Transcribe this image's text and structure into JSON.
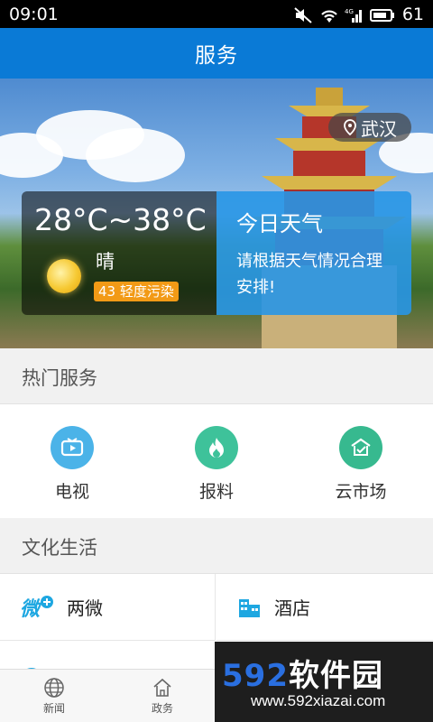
{
  "status_bar": {
    "time": "09:01",
    "network": "4G",
    "battery": "61"
  },
  "header": {
    "title": "服务"
  },
  "location": {
    "city": "武汉"
  },
  "weather": {
    "temperature": "28°C~38°C",
    "condition": "晴",
    "air_quality": "43 轻度污染"
  },
  "tip": {
    "title": "今日天气",
    "text": "请根据天气情况合理安排!"
  },
  "hot_services": {
    "title": "热门服务",
    "items": [
      {
        "label": "电视",
        "icon": "tv-icon",
        "color": "#4bb3e8"
      },
      {
        "label": "报料",
        "icon": "fire-icon",
        "color": "#3ec29a"
      },
      {
        "label": "云市场",
        "icon": "market-icon",
        "color": "#37b98f"
      }
    ]
  },
  "culture": {
    "title": "文化生活",
    "items": [
      {
        "label": "两微",
        "icon": "weibo-weixin-icon",
        "color": "#1ea7e1"
      },
      {
        "label": "酒店",
        "icon": "hotel-icon",
        "color": "#1ea7e1"
      }
    ]
  },
  "bottom_nav": {
    "items": [
      {
        "label": "新闻",
        "icon": "globe-icon"
      },
      {
        "label": "政务",
        "icon": "home-icon"
      }
    ]
  },
  "watermark": {
    "logo_num": "592",
    "logo_text": "软件园",
    "url": "www.592xiazai.com"
  }
}
